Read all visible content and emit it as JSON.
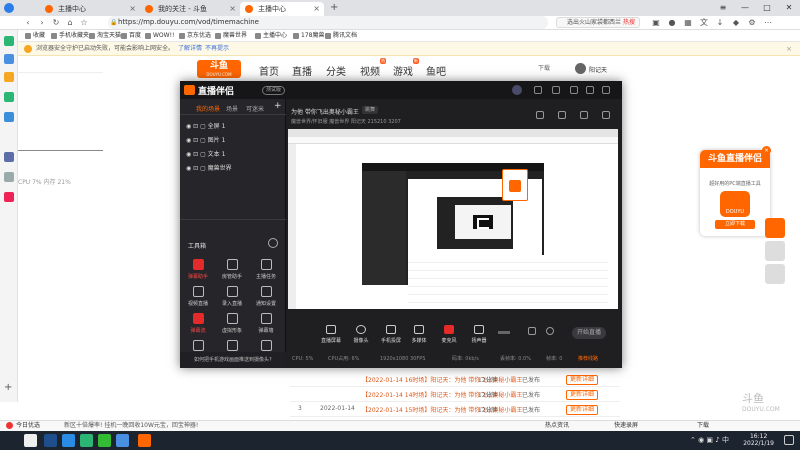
{
  "browser": {
    "tabs": [
      {
        "title": "主播中心",
        "active": false
      },
      {
        "title": "我的关注 - 斗鱼",
        "active": false
      },
      {
        "title": "主播中心",
        "active": true
      }
    ],
    "add_tab": "+",
    "url": "https://mp.douyu.com/vod/timemachine",
    "search_placeholder": "选出火山家袋都西兰",
    "search_hot": "热搜",
    "bookmarks": [
      "收藏",
      "手机收藏夹",
      "淘宝天猫",
      "百度",
      "WOW!!",
      "京东优选",
      "魔兽世界",
      "主播中心",
      "178魔兽",
      "腾讯文档"
    ],
    "info_text": "浏览器安全守护已启动失败，可能会影响上网安全。",
    "info_link1": "了解详情",
    "info_link2": "不再提示",
    "info_close": "×"
  },
  "douyu": {
    "logo": "斗鱼",
    "logo_sub": "DOUYU.COM",
    "nav": [
      "首页",
      "直播",
      "分类",
      "视频",
      "游戏",
      "鱼吧"
    ],
    "nav_tag_video": "热",
    "nav_tag_game": "新",
    "download": "下载",
    "username": "阳记天",
    "left_stats": "CPU 7% 内存 21%",
    "table": {
      "row_index": "3",
      "row_date": "2022-01-14",
      "links": [
        "【2022-01-14 16时场】阳记天：为他 带你飞出奥秘小霸王",
        "【2022-01-14 14时场】阳记天：为他 带你飞出奥秘小霸王",
        "【2022-01-14 15时场】阳记天：为他 带你飞出奥秘小霸王",
        "【2022-01-14 16时场】阳记天：为他 带你飞出奥秘小霸王"
      ],
      "durations": [
        "12分钟",
        "12分钟",
        "12分钟",
        "12分钟"
      ],
      "status": [
        "已发布",
        "已发布",
        "已发布",
        "已发布"
      ],
      "action": "更新详细"
    },
    "promo": {
      "title": "斗鱼直播伴侣",
      "subtitle": "超好用的PC端直播工具",
      "icon_label": "DOUYU",
      "button": "立即下载"
    },
    "watermark": "斗鱼",
    "watermark_sub": "DOUYU.COM"
  },
  "app": {
    "name": "直播伴侣",
    "beta": "测试版",
    "source_tabs": [
      "我的场景",
      "场景",
      "可迷米"
    ],
    "sources": [
      "全屏 1",
      "图片 1",
      "文本 1",
      "魔兽世界"
    ],
    "add_source": "+",
    "tools_header": "工具箱",
    "tools": [
      {
        "label": "弹幕助手",
        "red": true
      },
      {
        "label": "房管助手",
        "red": false
      },
      {
        "label": "主播任务",
        "red": false
      },
      {
        "label": "视频直播",
        "red": false
      },
      {
        "label": "录入直播",
        "red": false
      },
      {
        "label": "通知设置",
        "red": false
      },
      {
        "label": "弹幕流",
        "red": true
      },
      {
        "label": "虚拟形象",
        "red": false
      },
      {
        "label": "弹幕墙",
        "red": false
      },
      {
        "label": "",
        "red": false
      },
      {
        "label": "",
        "red": false
      },
      {
        "label": "",
        "red": false
      }
    ],
    "phone_msg": "如何把手机游戏画面推送到摄像头?",
    "scene_title": "为他 带你飞出奥秘小霸王",
    "scene_tag": "跳舞",
    "scene_sub": "魔兽世界/怀旧服   魔兽世界   阳记天   215210   3207",
    "main_tools": [
      "直播屏幕",
      "摄像头",
      "手机投屏",
      "多媒体",
      "麦克风",
      "扬声器"
    ],
    "start_live": "开始直播",
    "status": [
      "CPU: 5%",
      "CPU占用: 6%",
      "1920x1080 30FPS",
      "码率: 0kb/s",
      "丢帧率: 0.0%",
      "帧率: 0",
      "推荐线路",
      "合作推"
    ]
  },
  "bottom": {
    "dl_left": "今日优选",
    "dl_mid": "新区十倍爆率! 挂机一晚回收10W元宝，回宝神器!",
    "dl_right": [
      "热点资讯",
      "快速录屏",
      "下载"
    ],
    "clock_time": "16:12",
    "clock_date": "2022/1/19"
  },
  "colors": {
    "accent": "#ff6600",
    "app_bg": "#1f1f22",
    "taskbar": "#1c2430"
  }
}
